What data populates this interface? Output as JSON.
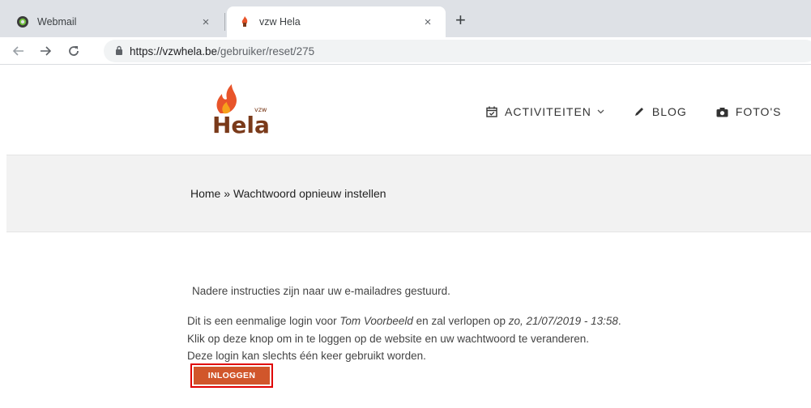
{
  "browser": {
    "tabs": [
      {
        "title": "Webmail",
        "icon": "webmail-favicon",
        "active": false
      },
      {
        "title": "vzw Hela",
        "icon": "hela-favicon",
        "active": true
      }
    ],
    "close_glyph": "×",
    "new_tab_glyph": "+",
    "url_host": "https://vzwhela.be",
    "url_path": "/gebruiker/reset/275"
  },
  "site": {
    "logo_text": "Hela",
    "logo_sub": "vzw",
    "nav": [
      {
        "label": "ACTIVITEITEN",
        "icon": "calendar-icon",
        "has_dropdown": true
      },
      {
        "label": "BLOG",
        "icon": "pencil-icon",
        "has_dropdown": false
      },
      {
        "label": "FOTO'S",
        "icon": "camera-icon",
        "has_dropdown": false
      }
    ],
    "dropdown_glyph": "⌄"
  },
  "breadcrumb": {
    "home": "Home",
    "separator": " » ",
    "current": "Wachtwoord opnieuw instellen"
  },
  "content": {
    "status_message": "Nadere instructies zijn naar uw e-mailadres gestuurd.",
    "line1_prefix": "Dit is een eenmalige login voor ",
    "user_name": "Tom Voorbeeld",
    "line1_middle": " en zal verlopen op ",
    "expiry": "zo, 21/07/2019 - 13:58",
    "line1_suffix": ".",
    "line2": "Klik op deze knop om in te loggen op de website en uw wachtwoord te veranderen.",
    "line3": "Deze login kan slechts één keer gebruikt worden.",
    "login_button": "INLOGGEN"
  },
  "colors": {
    "accent": "#d1562b",
    "highlight_border": "#e00000",
    "band": "#f2f2f2"
  }
}
